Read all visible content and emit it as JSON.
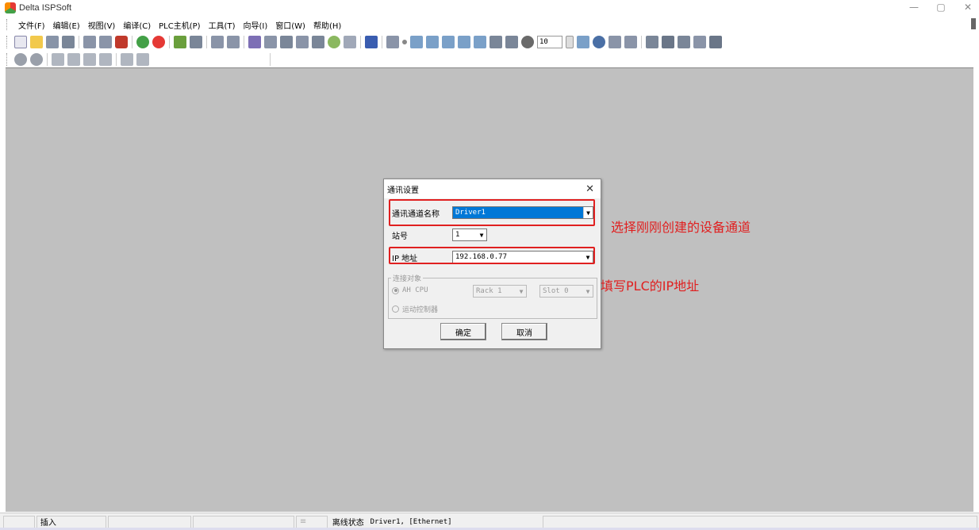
{
  "window": {
    "title": "Delta ISPSoft",
    "minimize": "—",
    "maximize": "▢",
    "close": "✕"
  },
  "menu": [
    "文件(F)",
    "编辑(E)",
    "视图(V)",
    "编译(C)",
    "PLC主机(P)",
    "工具(T)",
    "向导(I)",
    "窗口(W)",
    "帮助(H)"
  ],
  "toolbar": {
    "counter_value": "10"
  },
  "colors": {
    "accent": "#0078d7",
    "annotation": "#e02020",
    "workspace": "#c0c0c0"
  },
  "dialog": {
    "title": "通讯设置",
    "close": "✕",
    "channel_label": "通讯通道名称",
    "channel_value": "Driver1",
    "station_label": "站号",
    "station_value": "1",
    "ip_label": "IP 地址",
    "ip_value": "192.168.0.77",
    "group_label": "连接对象",
    "radio_ah": "AH CPU",
    "rack_value": "Rack 1",
    "slot_value": "Slot 0",
    "radio_motion": "运动控制器",
    "ok_label": "确定",
    "cancel_label": "取消"
  },
  "annotations": {
    "channel_note": "选择刚刚创建的设备通道",
    "ip_note": "填写PLC的IP地址"
  },
  "status": {
    "mode": "插入",
    "state": "离线状态",
    "connection": "Driver1, [Ethernet]"
  }
}
